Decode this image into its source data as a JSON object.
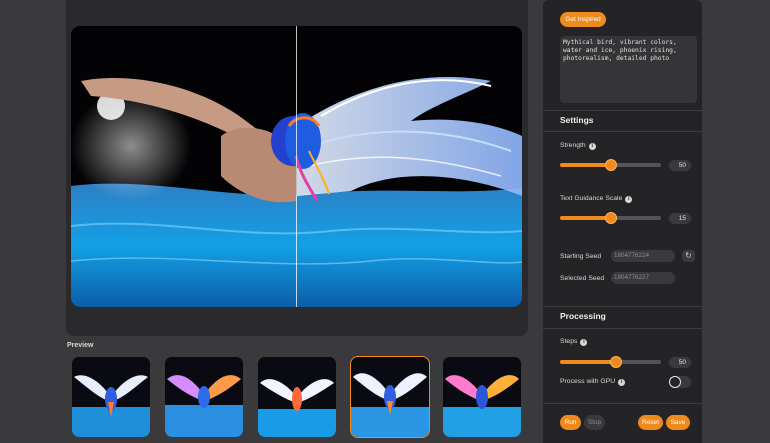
{
  "preview": {
    "label": "Preview",
    "thumbnails": [
      {
        "name": "variant-1",
        "selected": false
      },
      {
        "name": "variant-2",
        "selected": false
      },
      {
        "name": "variant-3",
        "selected": false
      },
      {
        "name": "variant-4",
        "selected": true
      },
      {
        "name": "variant-5",
        "selected": false
      }
    ]
  },
  "sidebar": {
    "get_inspired_label": "Get Inspired",
    "prompt_text": "Mythical bird, vibrant colors,\nwater and ice, phoenix rising,\nphotorealism, detailed photo",
    "settings": {
      "title": "Settings",
      "strength": {
        "label": "Strength",
        "value": "50",
        "fraction": 0.5
      },
      "guidance": {
        "label": "Text Guidance Scale",
        "value": "15",
        "fraction": 0.5
      },
      "starting_seed": {
        "label": "Starting Seed",
        "placeholder": "1804776224"
      },
      "selected_seed": {
        "label": "Selected Seed",
        "placeholder": "1804776227"
      }
    },
    "processing": {
      "title": "Processing",
      "steps": {
        "label": "Steps",
        "value": "50",
        "fraction": 0.55
      },
      "gpu": {
        "label": "Process with GPU",
        "on": false
      }
    },
    "buttons": {
      "run": "Run",
      "stop": "Stop",
      "reset": "Reset",
      "save": "Save"
    }
  },
  "colors": {
    "accent": "#f08a1c",
    "panel": "#242325",
    "background": "#3a393b"
  },
  "icons": {
    "info": "info-icon",
    "refresh": "refresh-icon"
  }
}
